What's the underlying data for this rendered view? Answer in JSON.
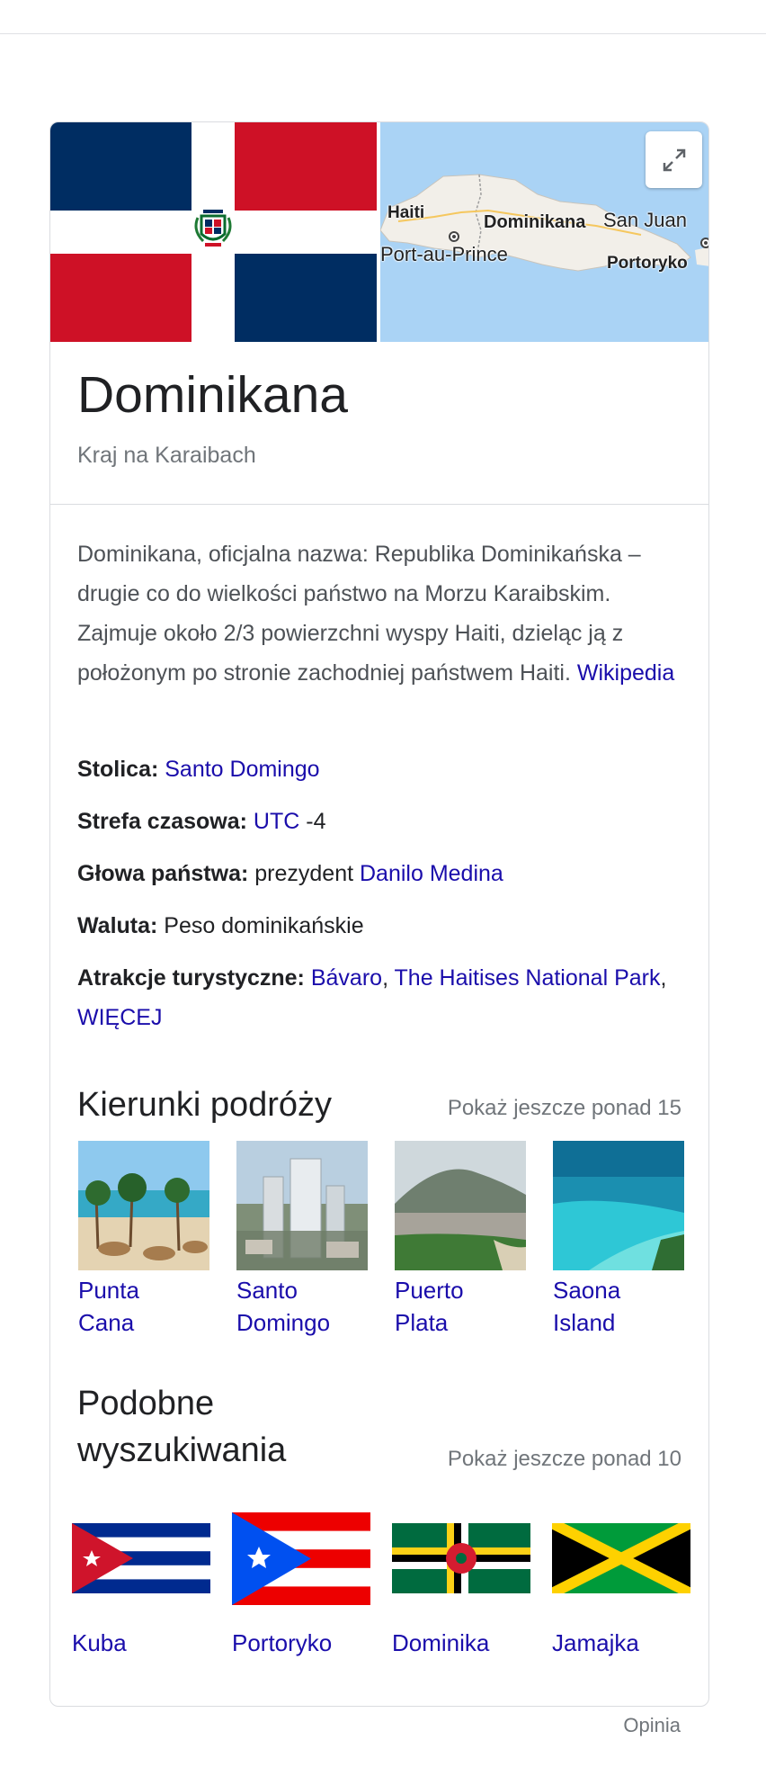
{
  "entity": {
    "title": "Dominikana",
    "subtitle": "Kraj na Karaibach"
  },
  "map": {
    "labels": {
      "haiti": "Haiti",
      "dominikana": "Dominikana",
      "san_juan": "San Juan",
      "port_au_prince": "Port-au-Prince",
      "portoryko": "Portoryko"
    }
  },
  "description": {
    "text": "Dominikana, oficjalna nazwa: Republika Dominikańska – drugie co do wielkości państwo na Morzu Karaibskim. Zajmuje około 2/3 powierzchni wyspy Haiti, dzieląc ją z położonym po stronie zachodniej państwem Haiti. ",
    "source_link": "Wikipedia"
  },
  "facts": {
    "capital_label": "Stolica:",
    "capital_value": "Santo Domingo",
    "timezone_label": "Strefa czasowa:",
    "timezone_link": "UTC",
    "timezone_suffix": " -4",
    "head_label": "Głowa państwa:",
    "head_prefix": " prezydent ",
    "head_link": "Danilo Medina",
    "currency_label": "Waluta:",
    "currency_value": " Peso dominikańskie",
    "attractions_label": "Atrakcje turystyczne:",
    "attraction_1": "Bávaro",
    "attraction_2": "The Haitises National Park",
    "attraction_more": "WIĘCEJ",
    "separator": ", "
  },
  "destinations": {
    "title": "Kierunki podróży",
    "more": "Pokaż jeszcze ponad 15",
    "items": [
      {
        "line1": "Punta",
        "line2": "Cana"
      },
      {
        "line1": "Santo",
        "line2": "Domingo"
      },
      {
        "line1": "Puerto",
        "line2": "Plata"
      },
      {
        "line1": "Saona",
        "line2": "Island"
      }
    ]
  },
  "similar": {
    "title_line1": "Podobne",
    "title_line2": "wyszukiwania",
    "more": "Pokaż jeszcze ponad 10",
    "items": [
      {
        "label": "Kuba"
      },
      {
        "label": "Portoryko"
      },
      {
        "label": "Dominika"
      },
      {
        "label": "Jamajka"
      }
    ]
  },
  "footer": {
    "feedback": "Opinia"
  },
  "colors": {
    "link": "#1a0dab",
    "muted": "#70757a",
    "dr_blue": "#002d62",
    "dr_red": "#ce1126"
  }
}
